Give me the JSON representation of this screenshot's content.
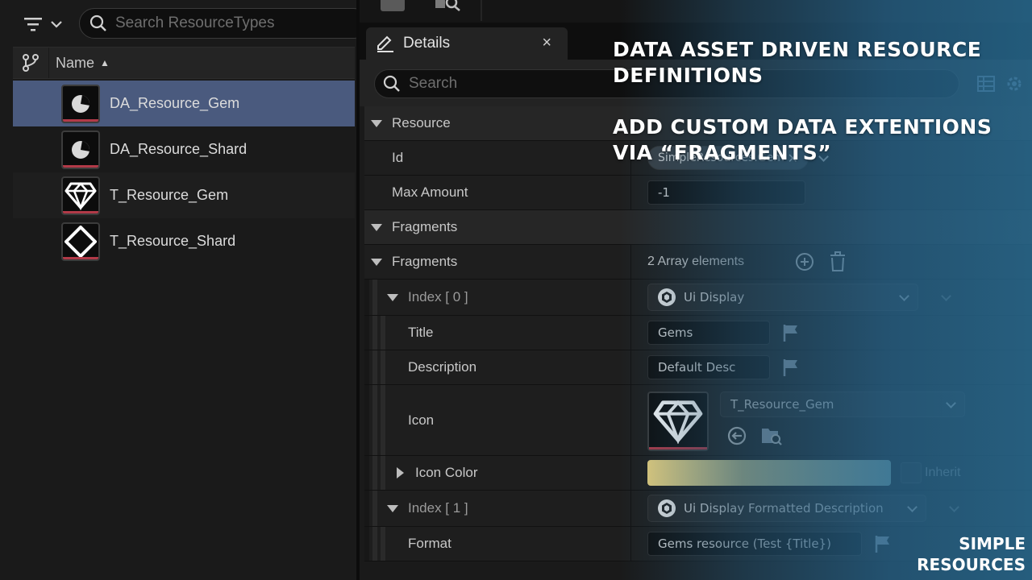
{
  "content_browser": {
    "search_placeholder": "Search ResourceTypes",
    "column_name": "Name",
    "sort_indicator": "▲",
    "items": [
      {
        "label": "DA_Resource_Gem",
        "icon": "data-asset-icon",
        "selected": true
      },
      {
        "label": "DA_Resource_Shard",
        "icon": "data-asset-icon",
        "selected": false
      },
      {
        "label": "T_Resource_Gem",
        "icon": "gem-texture-icon",
        "selected": false
      },
      {
        "label": "T_Resource_Shard",
        "icon": "shard-texture-icon",
        "selected": false
      }
    ]
  },
  "details": {
    "tab_title": "Details",
    "tab_close": "×",
    "search_placeholder": "Search",
    "categories": {
      "resource": "Resource",
      "fragments": "Fragments"
    },
    "id": {
      "label": "Id",
      "value": "SimpleResources.Gem"
    },
    "max_amount": {
      "label": "Max Amount",
      "value": "-1"
    },
    "fragments_array": {
      "label": "Fragments",
      "count_text": "2 Array elements"
    },
    "index0": {
      "label": "Index [ 0 ]",
      "type": "Ui Display",
      "title": {
        "label": "Title",
        "value": "Gems"
      },
      "description": {
        "label": "Description",
        "value": "Default Desc"
      },
      "icon": {
        "label": "Icon",
        "value": "T_Resource_Gem"
      },
      "icon_color": {
        "label": "Icon Color",
        "inherit_label": "Inherit"
      }
    },
    "index1": {
      "label": "Index [ 1 ]",
      "type": "Ui Display Formatted Description",
      "format": {
        "label": "Format",
        "value": "Gems resource (Test {Title})"
      }
    }
  },
  "overlay": {
    "caption_line1": "DATA ASSET DRIVEN RESOURCE DEFINITIONS",
    "caption_line2": "ADD CUSTOM DATA EXTENTIONS VIA “FRAGMENTS”",
    "brand_line1": "SIMPLE",
    "brand_line2": "RESOURCES"
  },
  "colors": {
    "selection": "#4a5a7e",
    "asset_underline": "#b23a48",
    "icon_color_gradient_start": "#e9d27f",
    "icon_color_gradient_end": "#8fb7b0",
    "overlay_blue": "#2a6e96"
  }
}
